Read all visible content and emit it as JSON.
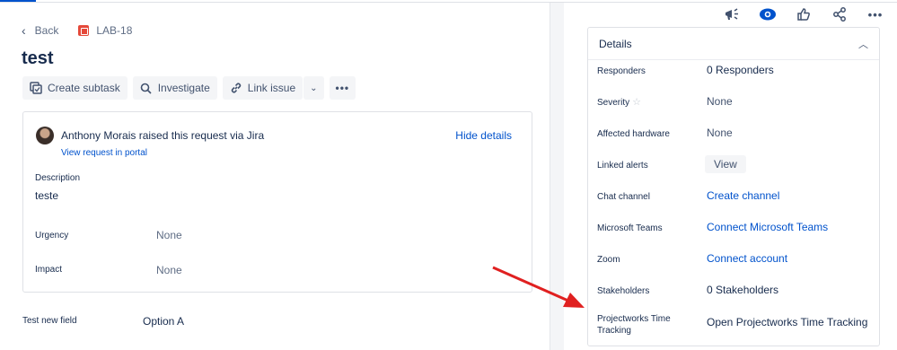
{
  "breadcrumb": {
    "back": "Back",
    "issue_key": "LAB-18"
  },
  "issue": {
    "title": "test"
  },
  "actions": {
    "create_subtask": "Create subtask",
    "investigate": "Investigate",
    "link_issue": "Link issue"
  },
  "request": {
    "reporter": "Anthony Morais",
    "raised_text": "raised this request via",
    "channel": "Jira",
    "view_portal": "View request in portal",
    "hide_details": "Hide details",
    "description_label": "Description",
    "description_value": "teste",
    "urgency_label": "Urgency",
    "urgency_value": "None",
    "impact_label": "Impact",
    "impact_value": "None"
  },
  "extra_field": {
    "label": "Test new field",
    "value": "Option A"
  },
  "details": {
    "title": "Details",
    "rows": [
      {
        "label": "Responders",
        "value": "0 Responders"
      },
      {
        "label": "Severity",
        "value": "None"
      },
      {
        "label": "Affected hardware",
        "value": "None"
      },
      {
        "label": "Linked alerts",
        "value": "View"
      },
      {
        "label": "Chat channel",
        "value": "Create channel"
      },
      {
        "label": "Microsoft Teams",
        "value": "Connect Microsoft Teams"
      },
      {
        "label": "Zoom",
        "value": "Connect account"
      },
      {
        "label": "Stakeholders",
        "value": "0 Stakeholders"
      },
      {
        "label": "Projectworks Time Tracking",
        "value": "Open Projectworks Time Tracking"
      }
    ]
  },
  "colors": {
    "link": "#0052cc",
    "arrow": "#e02020",
    "issue_icon": "#e5493a"
  },
  "icons": [
    "chevron-left-icon",
    "issue-type-icon",
    "subtask-icon",
    "search-icon",
    "link-icon",
    "chevron-down-icon",
    "more-icon",
    "announce-icon",
    "watch-icon",
    "like-icon",
    "share-icon",
    "star-icon",
    "chevron-up-icon"
  ]
}
